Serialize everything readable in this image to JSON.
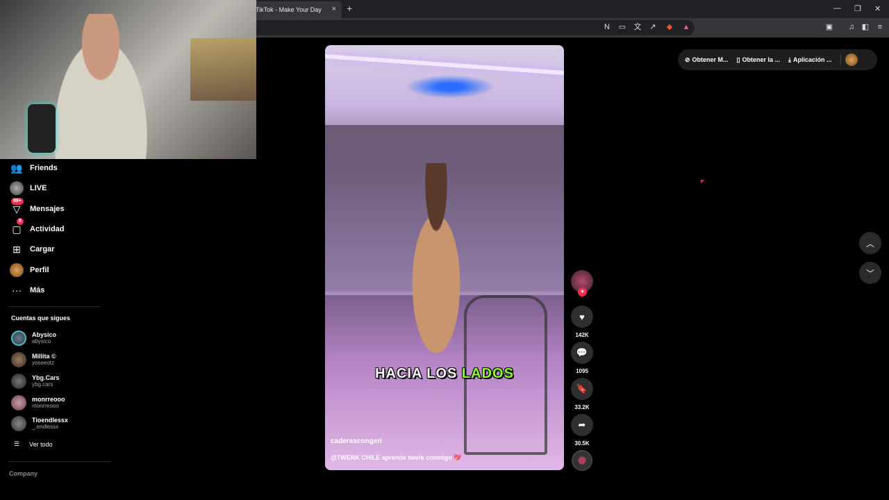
{
  "browser": {
    "tab_title": "TikTok - Make Your Day",
    "new_tab": "+",
    "close_tab": "×"
  },
  "sidebar": {
    "items": [
      {
        "label": "Friends",
        "icon": "friends-icon"
      },
      {
        "label": "LIVE",
        "icon": "live-icon"
      },
      {
        "label": "Mensajes",
        "icon": "messages-icon",
        "badge": "99+"
      },
      {
        "label": "Actividad",
        "icon": "activity-icon",
        "badge": "5"
      },
      {
        "label": "Cargar",
        "icon": "upload-icon"
      },
      {
        "label": "Perfil",
        "icon": "profile-avatar"
      },
      {
        "label": "Más",
        "icon": "more-icon"
      }
    ],
    "following_title": "Cuentas que sigues",
    "following": [
      {
        "name": "Abysico",
        "handle": "abysico"
      },
      {
        "name": "Millita ©",
        "handle": "yoseeotz"
      },
      {
        "name": "Ybg.Cars",
        "handle": "ybg.cars"
      },
      {
        "name": "monrreooo",
        "handle": "monrreooo"
      },
      {
        "name": "Tioendlessx",
        "handle": "_.endlessx"
      }
    ],
    "see_all": "Ver todo",
    "company": "Company"
  },
  "video": {
    "caption_part1": "HACIA LOS ",
    "caption_part2": "LADOS",
    "author": "caderascongeri",
    "description": "@TWERK CHILE aprende twerk conmigo 💖"
  },
  "actions": {
    "likes": "142K",
    "comments": "1095",
    "saves": "33.2K",
    "shares": "30.5K"
  },
  "top_pill": {
    "btn1": "Obtener M...",
    "btn2": "Obtener la ...",
    "btn3": "Aplicación ..."
  },
  "colors": {
    "accent": "#fe2c55",
    "highlight": "#8cff2a",
    "background": "#000000"
  }
}
